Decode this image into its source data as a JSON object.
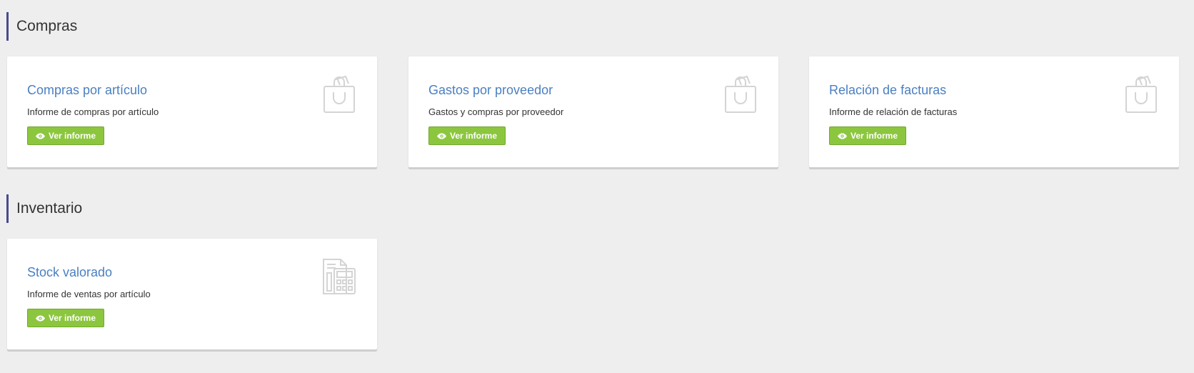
{
  "sections": [
    {
      "title": "Compras",
      "cards": [
        {
          "title": "Compras por artículo",
          "description": "Informe de compras por artículo",
          "button_label": "Ver informe",
          "icon": "shopping-bag-icon"
        },
        {
          "title": "Gastos por proveedor",
          "description": "Gastos y compras por proveedor",
          "button_label": "Ver informe",
          "icon": "shopping-bag-icon"
        },
        {
          "title": "Relación de facturas",
          "description": "Informe de relación de facturas",
          "button_label": "Ver informe",
          "icon": "shopping-bag-icon"
        }
      ]
    },
    {
      "title": "Inventario",
      "cards": [
        {
          "title": "Stock valorado",
          "description": "Informe de ventas por artículo",
          "button_label": "Ver informe",
          "icon": "calculator-icon"
        }
      ]
    }
  ],
  "colors": {
    "background": "#eeeeee",
    "accent_border": "#4a4a8c",
    "link": "#4a7fc1",
    "button": "#8cc63f",
    "icon": "#d4d4d4"
  }
}
